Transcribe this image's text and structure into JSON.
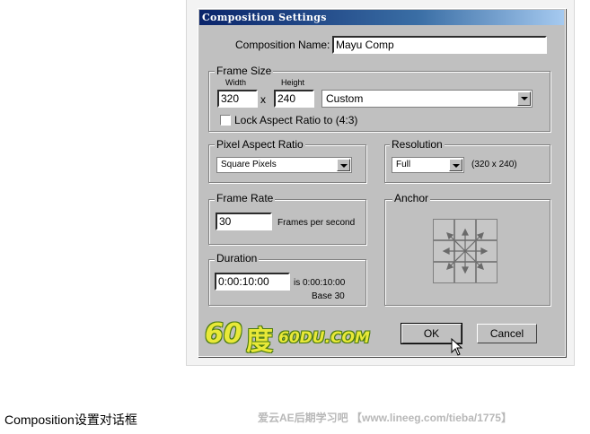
{
  "dialog": {
    "title": "Composition Settings",
    "composition_name_label": "Composition Name:",
    "composition_name_value": "Mayu Comp",
    "frame_size": {
      "group_label": "Frame Size",
      "width_label": "Width",
      "height_label": "Height",
      "width_value": "320",
      "times": "x",
      "height_value": "240",
      "preset_value": "Custom",
      "lock_aspect_label": "Lock Aspect Ratio to (4:3)",
      "lock_aspect_checked": false
    },
    "pixel_aspect": {
      "group_label": "Pixel Aspect Ratio",
      "value": "Square Pixels"
    },
    "resolution": {
      "group_label": "Resolution",
      "value": "Full",
      "size_readout": "(320 x 240)"
    },
    "frame_rate": {
      "group_label": "Frame Rate",
      "value": "30",
      "unit": "Frames per second"
    },
    "anchor": {
      "group_label": "Anchor",
      "icon": "anchor-arrows-icon"
    },
    "duration": {
      "group_label": "Duration",
      "value": "0:00:10:00",
      "is_readout": "is 0:00:10:00",
      "base_readout": "Base 30"
    },
    "ok_label": "OK",
    "cancel_label": "Cancel"
  },
  "logo": {
    "num": "60",
    "cn": "度",
    "domain": "60DU.COM"
  },
  "caption": "Composition设置对话框",
  "watermark": "爱云AE后期学习吧 【www.lineeg.com/tieba/1775】",
  "colors": {
    "dialog_bg": "#c0c0c0",
    "titlebar_start": "#0a246a",
    "titlebar_end": "#a6caf0",
    "logo_yellow": "#e8e838"
  }
}
